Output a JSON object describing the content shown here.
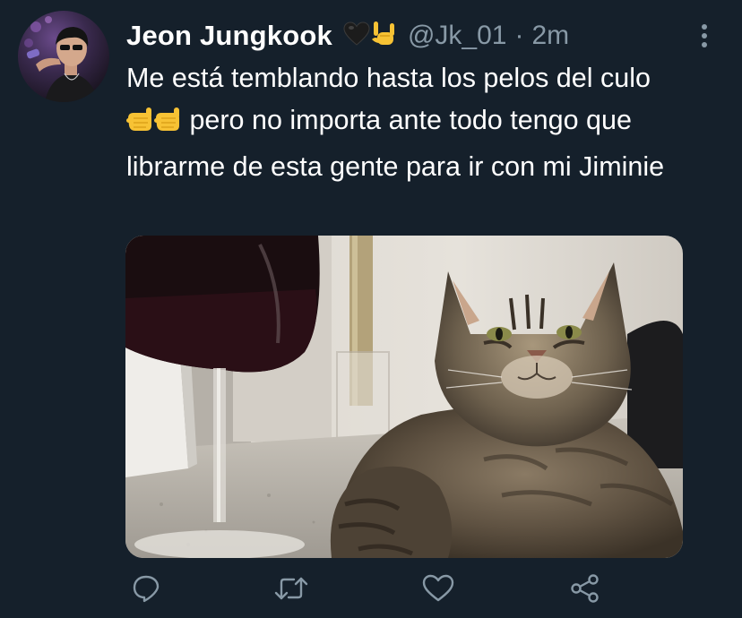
{
  "tweet": {
    "display_name": "Jeon Jungkook",
    "name_emojis": [
      "black-heart-emoji",
      "love-you-gesture-emoji"
    ],
    "handle": "@Jk_01",
    "separator": "·",
    "time": "2m",
    "text_before": "Me está temblando hasta los pelos del culo ",
    "inline_emojis": [
      "call-me-hand-emoji",
      "call-me-hand-emoji"
    ],
    "text_after": " pero no importa ante todo tengo que librarme de esta gente para ir con mi Jiminie",
    "media_description": "photo-cat-with-wine-glass"
  },
  "actions": {
    "icons": [
      "reply-icon",
      "retweet-icon",
      "like-icon",
      "share-icon"
    ]
  },
  "colors": {
    "background": "#15202b",
    "text": "#ffffff",
    "secondary": "#8899a6"
  }
}
